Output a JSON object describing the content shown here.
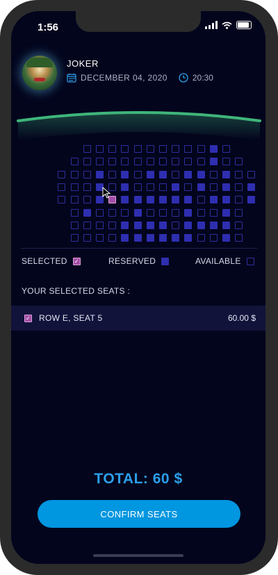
{
  "status_bar": {
    "time": "1:56"
  },
  "movie": {
    "title": "JOKER",
    "date": "DECEMBER 04, 2020",
    "time": "20:30"
  },
  "seat_map": {
    "rows": [
      "....AAAAAAAAAARA....",
      "...AAAAAAAAAAARAA...",
      "..AAARARARRARRARAA..",
      "..AAARARAAARARARAR..",
      "..AAARSRRRRRRARRAR..",
      "...ARAAARAAARAARA...",
      "...AAAARRRRARRRRA...",
      "...AAAARRRRRRAARA..."
    ],
    "selected_seat": {
      "row": "E",
      "seat": 5
    }
  },
  "legend": {
    "selected": "SELECTED",
    "reserved": "RESERVED",
    "available": "AVAILABLE"
  },
  "your_seats": {
    "heading": "YOUR SELECTED SEATS :",
    "items": [
      {
        "label": "ROW E, SEAT 5",
        "price": "60.00 $"
      }
    ]
  },
  "total": "TOTAL: 60 $",
  "confirm_label": "CONFIRM SEATS",
  "colors": {
    "background": "#03051d",
    "accent": "#0096e0",
    "total": "#2b9fea",
    "reserved": "#2e2eb0",
    "selected": "#a44fa6",
    "screen_arc": "#3fb57a"
  }
}
